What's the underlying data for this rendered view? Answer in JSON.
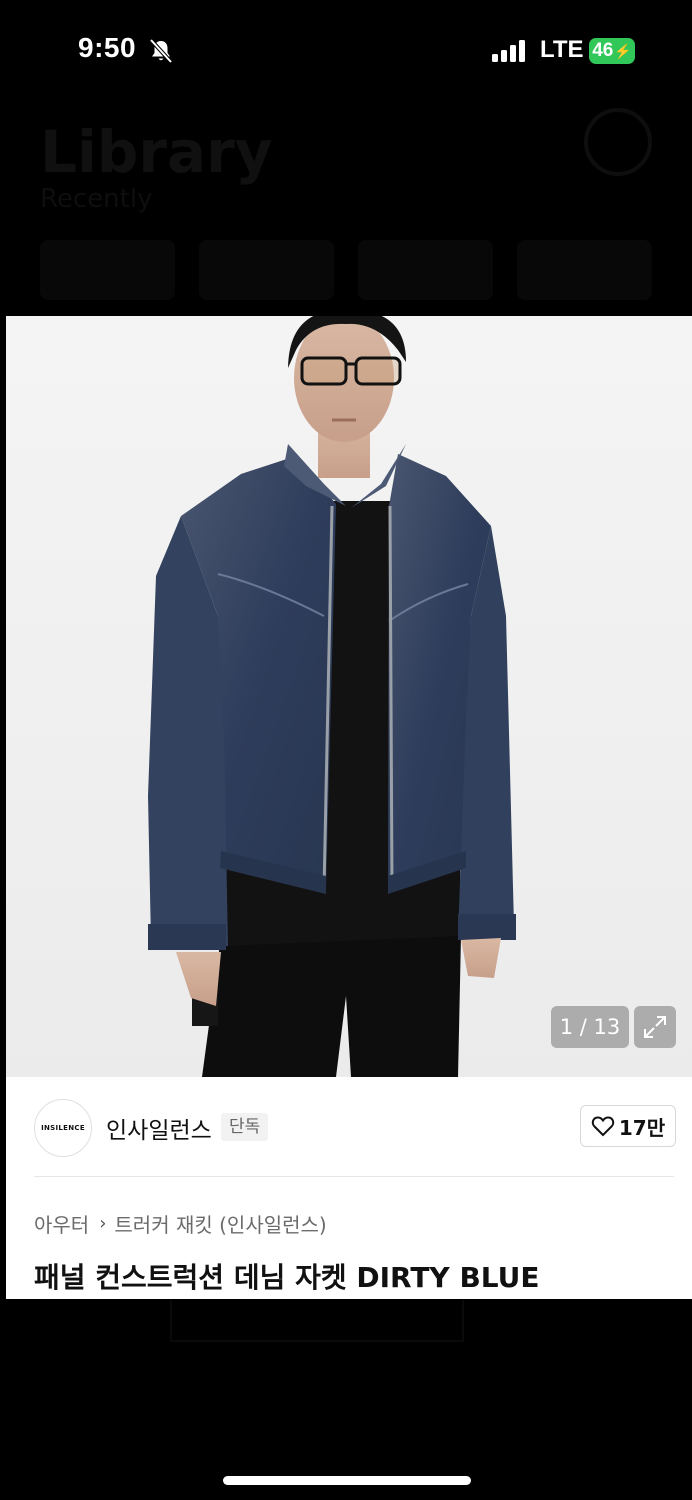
{
  "status_bar": {
    "time": "9:50",
    "network": "LTE",
    "battery": "46"
  },
  "background_app": {
    "title": "Library",
    "subtitle": "Recently"
  },
  "product": {
    "image_counter": "1 / 13",
    "brand": {
      "logo_text": "INSILENCE",
      "name": "인사일런스",
      "badge": "단독"
    },
    "likes": "17만",
    "breadcrumb": {
      "category": "아우터",
      "subcategory": "트러커 재킷 (인사일런스)"
    },
    "title": "패널 컨스트럭션 데님 자켓 DIRTY BLUE"
  },
  "colors": {
    "background": "#000000",
    "card": "#ffffff",
    "battery_green": "#31c759",
    "denim": "#2f3f5c"
  },
  "icons": [
    "bell-slash-icon",
    "signal-icon",
    "bolt-icon",
    "expand-icon",
    "heart-icon",
    "chevron-right-icon"
  ]
}
